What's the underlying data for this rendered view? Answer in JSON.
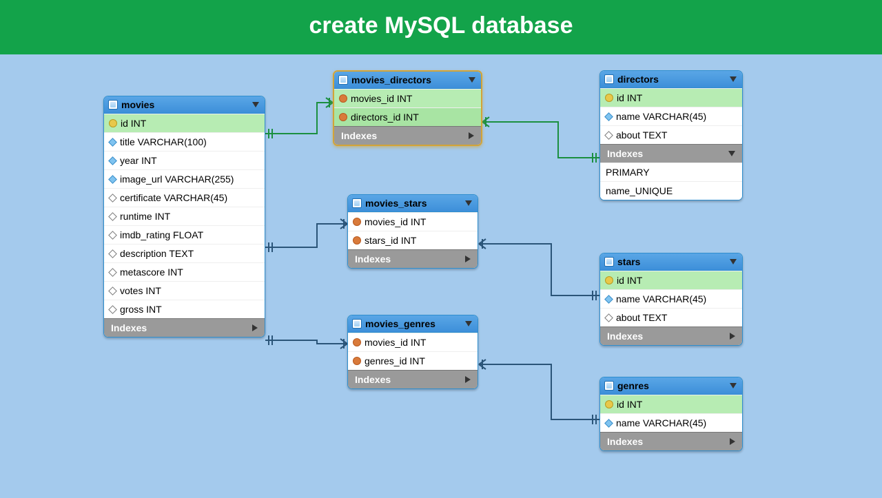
{
  "header": {
    "title": "create MySQL database"
  },
  "colors": {
    "header_bg": "#13a34a",
    "canvas_bg": "#a4caed",
    "table_header": "#4a99e0",
    "pk_bg": "#b7ecb3"
  },
  "icons": {
    "table": "table-icon",
    "collapse": "chevron-down-icon",
    "expand": "play-icon",
    "pk": "key-icon",
    "fk": "key-icon-red",
    "col": "diamond-icon",
    "col_null": "diamond-hollow-icon"
  },
  "tables": {
    "movies": {
      "title": "movies",
      "indexes_label": "Indexes",
      "columns": [
        {
          "name": "id INT",
          "kind": "pk"
        },
        {
          "name": "title VARCHAR(100)",
          "kind": "col"
        },
        {
          "name": "year INT",
          "kind": "col"
        },
        {
          "name": "image_url VARCHAR(255)",
          "kind": "col"
        },
        {
          "name": "certificate VARCHAR(45)",
          "kind": "col_null"
        },
        {
          "name": "runtime INT",
          "kind": "col_null"
        },
        {
          "name": "imdb_rating FLOAT",
          "kind": "col_null"
        },
        {
          "name": "description TEXT",
          "kind": "col_null"
        },
        {
          "name": "metascore INT",
          "kind": "col_null"
        },
        {
          "name": "votes INT",
          "kind": "col_null"
        },
        {
          "name": "gross INT",
          "kind": "col_null"
        }
      ]
    },
    "movies_directors": {
      "title": "movies_directors",
      "indexes_label": "Indexes",
      "selected": true,
      "columns": [
        {
          "name": "movies_id INT",
          "kind": "fk_pk"
        },
        {
          "name": "directors_id INT",
          "kind": "fk_pk"
        }
      ]
    },
    "directors": {
      "title": "directors",
      "indexes_label": "Indexes",
      "columns": [
        {
          "name": "id INT",
          "kind": "pk"
        },
        {
          "name": "name VARCHAR(45)",
          "kind": "col"
        },
        {
          "name": "about TEXT",
          "kind": "col_null"
        }
      ],
      "index_items": [
        {
          "name": "PRIMARY"
        },
        {
          "name": "name_UNIQUE"
        }
      ]
    },
    "movies_stars": {
      "title": "movies_stars",
      "indexes_label": "Indexes",
      "columns": [
        {
          "name": "movies_id INT",
          "kind": "fk"
        },
        {
          "name": "stars_id INT",
          "kind": "fk"
        }
      ]
    },
    "stars": {
      "title": "stars",
      "indexes_label": "Indexes",
      "columns": [
        {
          "name": "id INT",
          "kind": "pk"
        },
        {
          "name": "name VARCHAR(45)",
          "kind": "col"
        },
        {
          "name": "about TEXT",
          "kind": "col_null"
        }
      ]
    },
    "movies_genres": {
      "title": "movies_genres",
      "indexes_label": "Indexes",
      "columns": [
        {
          "name": "movies_id INT",
          "kind": "fk"
        },
        {
          "name": "genres_id INT",
          "kind": "fk"
        }
      ]
    },
    "genres": {
      "title": "genres",
      "indexes_label": "Indexes",
      "columns": [
        {
          "name": "id INT",
          "kind": "pk"
        },
        {
          "name": "name VARCHAR(45)",
          "kind": "col"
        }
      ]
    }
  },
  "relationships": [
    {
      "from": "movies",
      "to": "movies_directors",
      "highlight": true
    },
    {
      "from": "movies_directors",
      "to": "directors",
      "highlight": true
    },
    {
      "from": "movies",
      "to": "movies_stars",
      "highlight": false
    },
    {
      "from": "movies_stars",
      "to": "stars",
      "highlight": false
    },
    {
      "from": "movies",
      "to": "movies_genres",
      "highlight": false
    },
    {
      "from": "movies_genres",
      "to": "genres",
      "highlight": false
    }
  ]
}
